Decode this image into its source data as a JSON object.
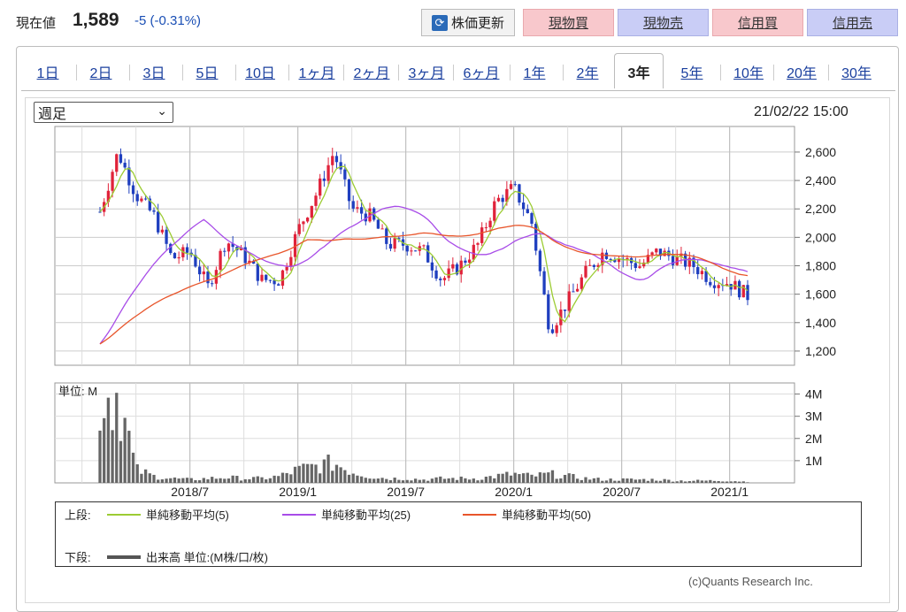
{
  "header": {
    "price_label": "現在値",
    "price_value": "1,589",
    "price_change": "-5 (-0.31%)",
    "refresh_label": "株価更新",
    "trade_buttons": [
      {
        "label": "現物買",
        "color": "#f8c8cc"
      },
      {
        "label": "現物売",
        "color": "#c9cdf6"
      },
      {
        "label": "信用買",
        "color": "#f8c8cc"
      },
      {
        "label": "信用売",
        "color": "#c9cdf6"
      }
    ]
  },
  "tabs": [
    "1日",
    "2日",
    "3日",
    "5日",
    "10日",
    "1ヶ月",
    "2ヶ月",
    "3ヶ月",
    "6ヶ月",
    "1年",
    "2年",
    "3年",
    "5年",
    "10年",
    "20年",
    "30年"
  ],
  "active_tab": "3年",
  "period_select": "週足",
  "datetime": "21/02/22 15:00",
  "chart_data": {
    "type": "candlestick",
    "price_axis": {
      "ticks": [
        1200,
        1400,
        1600,
        1800,
        2000,
        2200,
        2400,
        2600
      ],
      "tick_labels": [
        "1,200",
        "1,400",
        "1,600",
        "1,800",
        "2,000",
        "2,200",
        "2,400",
        "2,600"
      ],
      "range": [
        1100,
        2780
      ]
    },
    "volume_axis": {
      "unit_label": "単位: M",
      "ticks": [
        1,
        2,
        3,
        4
      ],
      "tick_labels": [
        "1M",
        "2M",
        "3M",
        "4M"
      ],
      "range": [
        0,
        4.5
      ]
    },
    "x_axis": {
      "labels": [
        "2018/7",
        "2019/1",
        "2019/7",
        "2020/1",
        "2020/7",
        "2021/1"
      ]
    },
    "close_points": [
      [
        "2018/2",
        2180
      ],
      [
        "2018/3",
        2600
      ],
      [
        "2018/4",
        2300
      ],
      [
        "2018/5",
        2150
      ],
      [
        "2018/6",
        1850
      ],
      [
        "2018/7",
        1900
      ],
      [
        "2018/8",
        1650
      ],
      [
        "2018/9",
        1980
      ],
      [
        "2018/10",
        1870
      ],
      [
        "2018/11",
        1700
      ],
      [
        "2018/12",
        1700
      ],
      [
        "2019/1",
        2050
      ],
      [
        "2019/2",
        2300
      ],
      [
        "2019/3",
        2600
      ],
      [
        "2019/4",
        2200
      ],
      [
        "2019/5",
        2150
      ],
      [
        "2019/6",
        1950
      ],
      [
        "2019/7",
        1950
      ],
      [
        "2019/8",
        1900
      ],
      [
        "2019/9",
        1700
      ],
      [
        "2019/10",
        1800
      ],
      [
        "2019/11",
        1950
      ],
      [
        "2019/12",
        2250
      ],
      [
        "2020/1",
        2350
      ],
      [
        "2020/2",
        2100
      ],
      [
        "2020/3",
        1350
      ],
      [
        "2020/4",
        1550
      ],
      [
        "2020/5",
        1750
      ],
      [
        "2020/6",
        1900
      ],
      [
        "2020/7",
        1850
      ],
      [
        "2020/8",
        1800
      ],
      [
        "2020/9",
        1900
      ],
      [
        "2020/10",
        1850
      ],
      [
        "2020/11",
        1800
      ],
      [
        "2020/12",
        1700
      ],
      [
        "2021/1",
        1680
      ],
      [
        "2021/2",
        1589
      ]
    ],
    "ma": [
      {
        "name": "単純移動平均(5)",
        "color": "#9ccc33"
      },
      {
        "name": "単純移動平均(25)",
        "color": "#a84ce8"
      },
      {
        "name": "単純移動平均(50)",
        "color": "#e8552b"
      }
    ],
    "volume_series_name": "出来高 単位:(M株/口/枚)",
    "volume_points": [
      [
        "2018/2",
        3.8
      ],
      [
        "2018/3",
        4.1
      ],
      [
        "2018/4",
        0.6
      ],
      [
        "2018/5",
        0.3
      ],
      [
        "2018/6",
        0.2
      ],
      [
        "2018/7",
        0.15
      ],
      [
        "2018/8",
        0.2
      ],
      [
        "2018/9",
        0.25
      ],
      [
        "2018/10",
        0.2
      ],
      [
        "2018/11",
        0.2
      ],
      [
        "2018/12",
        0.3
      ],
      [
        "2019/1",
        0.6
      ],
      [
        "2019/2",
        0.75
      ],
      [
        "2019/3",
        0.9
      ],
      [
        "2019/4",
        0.5
      ],
      [
        "2019/5",
        0.3
      ],
      [
        "2019/6",
        0.2
      ],
      [
        "2019/7",
        0.2
      ],
      [
        "2019/8",
        0.15
      ],
      [
        "2019/9",
        0.2
      ],
      [
        "2019/10",
        0.2
      ],
      [
        "2019/11",
        0.2
      ],
      [
        "2019/12",
        0.3
      ],
      [
        "2020/1",
        0.4
      ],
      [
        "2020/2",
        0.3
      ],
      [
        "2020/3",
        0.4
      ],
      [
        "2020/4",
        0.3
      ],
      [
        "2020/5",
        0.2
      ],
      [
        "2020/6",
        0.15
      ],
      [
        "2020/7",
        0.15
      ],
      [
        "2020/8",
        0.15
      ],
      [
        "2020/9",
        0.15
      ],
      [
        "2020/10",
        0.1
      ],
      [
        "2020/11",
        0.1
      ],
      [
        "2020/12",
        0.1
      ],
      [
        "2021/1",
        0.1
      ],
      [
        "2021/2",
        0.05
      ]
    ],
    "grid": true,
    "up_color": "#e0223a",
    "down_color": "#1f3fbf"
  },
  "legend": {
    "upper_label": "上段:",
    "lower_label": "下段:"
  },
  "copyright": "(c)Quants Research Inc."
}
